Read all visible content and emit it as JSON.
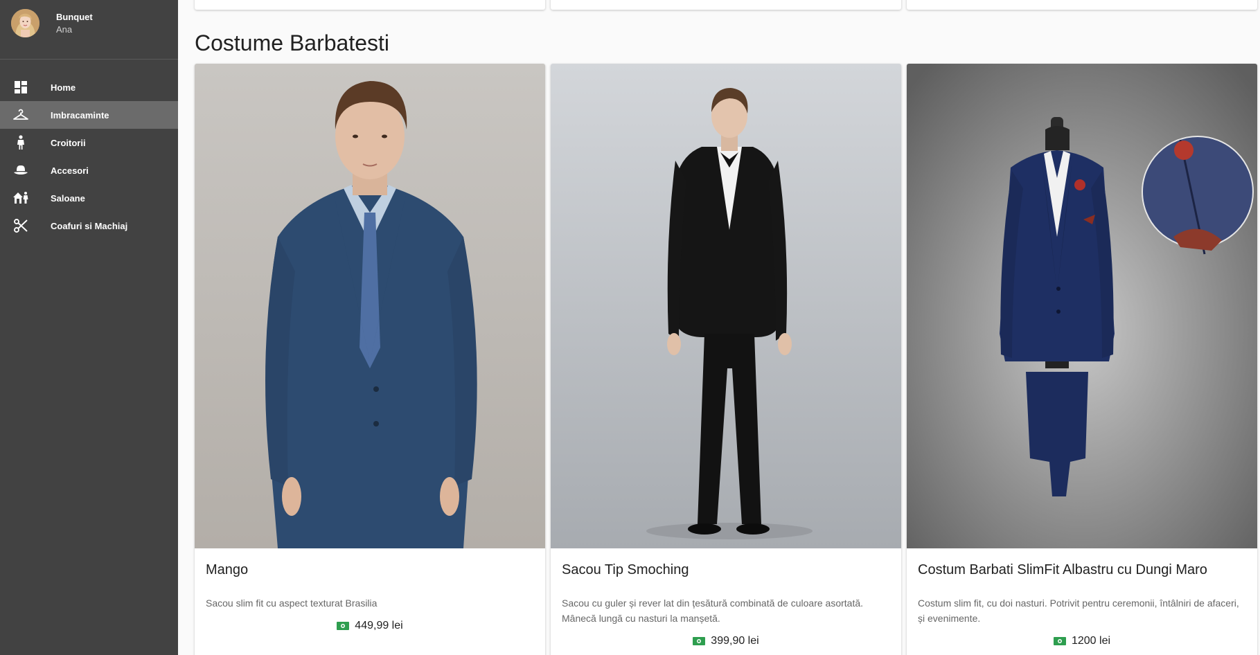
{
  "profile": {
    "name": "Bunquet",
    "subtitle": "Ana"
  },
  "nav": {
    "items": [
      {
        "label": "Home",
        "icon": "dashboard-icon",
        "active": false
      },
      {
        "label": "Imbracaminte",
        "icon": "hanger-icon",
        "active": true
      },
      {
        "label": "Croitorii",
        "icon": "person-icon",
        "active": false
      },
      {
        "label": "Accesori",
        "icon": "hat-icon",
        "active": false
      },
      {
        "label": "Saloane",
        "icon": "salon-icon",
        "active": false
      },
      {
        "label": "Coafuri si Machiaj",
        "icon": "scissors-icon",
        "active": false
      }
    ]
  },
  "section": {
    "title": "Costume Barbatesti"
  },
  "products": [
    {
      "title": "Mango",
      "description": "Sacou slim fit cu aspect texturat Brasilia",
      "price": "449,99 lei",
      "image": "man-in-blue-suit"
    },
    {
      "title": "Sacou Tip Smoching",
      "description": "Sacou cu guler și rever lat din țesătură combinată de culoare asortată. Mânecă lungă cu nasturi la manșetă.",
      "price": "399,90 lei",
      "image": "man-in-black-tuxedo"
    },
    {
      "title": "Costum Barbati SlimFit Albastru cu Dungi Maro",
      "description": "Costum slim fit, cu doi nasturi. Potrivit pentru ceremonii, întâlniri de afaceri, și evenimente.",
      "price": "1200 lei",
      "image": "navy-suit-on-mannequin"
    }
  ],
  "colors": {
    "sidebar_bg": "#424242",
    "sidebar_active": "#6b6b6b",
    "page_bg": "#fafafa",
    "price_icon": "#2e9e4f"
  }
}
